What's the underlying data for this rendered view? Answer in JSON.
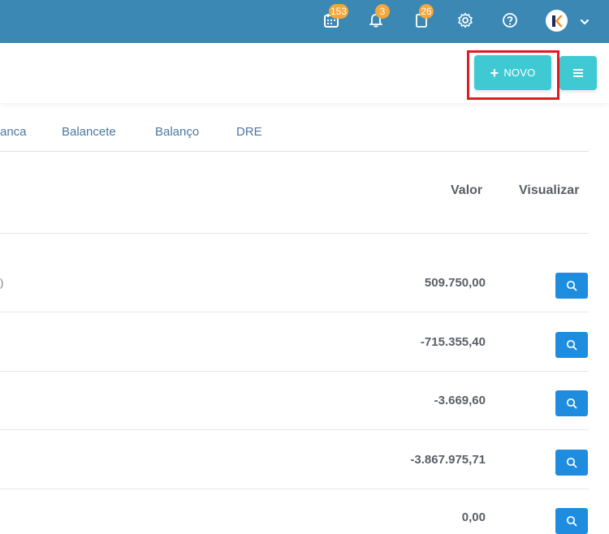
{
  "header": {
    "icons": [
      {
        "name": "calendar-icon",
        "badge": "153"
      },
      {
        "name": "bell-icon",
        "badge": "3"
      },
      {
        "name": "clipboard-icon",
        "badge": "26"
      },
      {
        "name": "gear-icon",
        "badge": ""
      },
      {
        "name": "help-icon",
        "badge": ""
      }
    ],
    "avatar_letter": "K"
  },
  "actions": {
    "novo_label": "NOVO",
    "novo_icon": "plus-icon",
    "menu_icon": "hamburger-icon"
  },
  "tabs": [
    "anca",
    "Balancete",
    "Balanço",
    "DRE"
  ],
  "table": {
    "columns": {
      "valor": "Valor",
      "visualizar": "Visualizar"
    },
    "rows": [
      {
        "prefix": ")",
        "valor": "509.750,00"
      },
      {
        "prefix": "",
        "valor": "-715.355,40"
      },
      {
        "prefix": "",
        "valor": "-3.669,60"
      },
      {
        "prefix": "",
        "valor": "-3.867.975,71"
      },
      {
        "prefix": "",
        "valor": "0,00"
      }
    ]
  },
  "colors": {
    "topbar": "#3b88b4",
    "accent": "#3fcad3",
    "view_button": "#1e8de0",
    "badge": "#f4a73a",
    "highlight": "#e11b22"
  }
}
